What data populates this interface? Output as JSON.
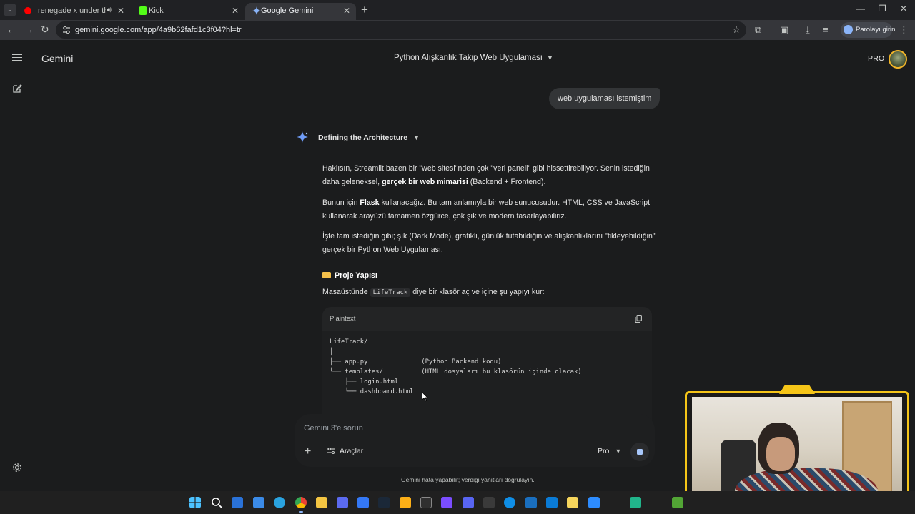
{
  "browser": {
    "tabs": [
      {
        "label": "renegade x under the influ",
        "favicon_color": "#ff0000",
        "audio": true,
        "active": false
      },
      {
        "label": "Kick",
        "favicon_color": "#53fc18",
        "audio": false,
        "active": false
      },
      {
        "label": "Google Gemini",
        "favicon_color": "#8ab4f8",
        "audio": false,
        "active": true
      }
    ],
    "url": "gemini.google.com/app/4a9b62fafd1c3f04?hl=tr",
    "profile_label": "Parolayı girin"
  },
  "app": {
    "brand": "Gemini",
    "conversation_title": "Python Alışkanlık Takip Web Uygulaması",
    "plan_label": "PRO",
    "user_message": "web uygulaması istemiştim",
    "thinking_label": "Defining the Architecture",
    "response": {
      "p1": {
        "a": "Haklısın, Streamlit bazen bir \"web sitesi\"nden çok \"veri paneli\" gibi hissettirebiliyor. Senin istediğin daha geleneksel, ",
        "b": "gerçek bir web mimarisi",
        "c": " (Backend + Frontend)."
      },
      "p2": {
        "a": "Bunun için ",
        "b": "Flask",
        "c": " kullanacağız. Bu tam anlamıyla bir web sunucusudur. HTML, CSS ve JavaScript kullanarak arayüzü tamamen özgürce, çok şık ve modern tasarlayabiliriz."
      },
      "p3": "İşte tam istediğin gibi; şık (Dark Mode), grafikli, günlük tutabildiğin ve alışkanlıklarını \"tikleyebildiğin\" gerçek bir Python Web Uygulaması.",
      "section_heading": "Proje Yapısı",
      "p4": {
        "a": "Masaüstünde ",
        "code": "LifeTrack",
        "c": " diye bir klasör aç ve içine şu yapıyı kur:"
      },
      "code_block": {
        "language": "Plaintext",
        "lines": [
          "LifeTrack/",
          "│",
          "├── app.py              (Python Backend kodu)",
          "└── templates/          (HTML dosyaları bu klasörün içinde olacak)",
          "    ├── login.html",
          "    └── dashboard.html"
        ]
      }
    },
    "composer": {
      "placeholder": "Gemini 3'e sorun",
      "tools_label": "Araçlar",
      "model_label": "Pro"
    },
    "disclaimer": "Gemini hata yapabilir; verdiği yanıtları doğrulayın."
  },
  "colors": {
    "background": "#1b1c1d",
    "accent_blue": "#a8c7fa",
    "webcam_frame": "#f5c518"
  },
  "taskbar": {
    "apps": [
      "windows-start",
      "search",
      "outlook",
      "store",
      "telegram",
      "chrome",
      "file-explorer",
      "vpn",
      "security",
      "steam",
      "rockstar",
      "epic-games",
      "vpn-2",
      "discord",
      "terminal",
      "skype",
      "virtual-box",
      "vscode",
      "sticky-notes",
      "zoom",
      "sandbox",
      "minecraft"
    ]
  }
}
